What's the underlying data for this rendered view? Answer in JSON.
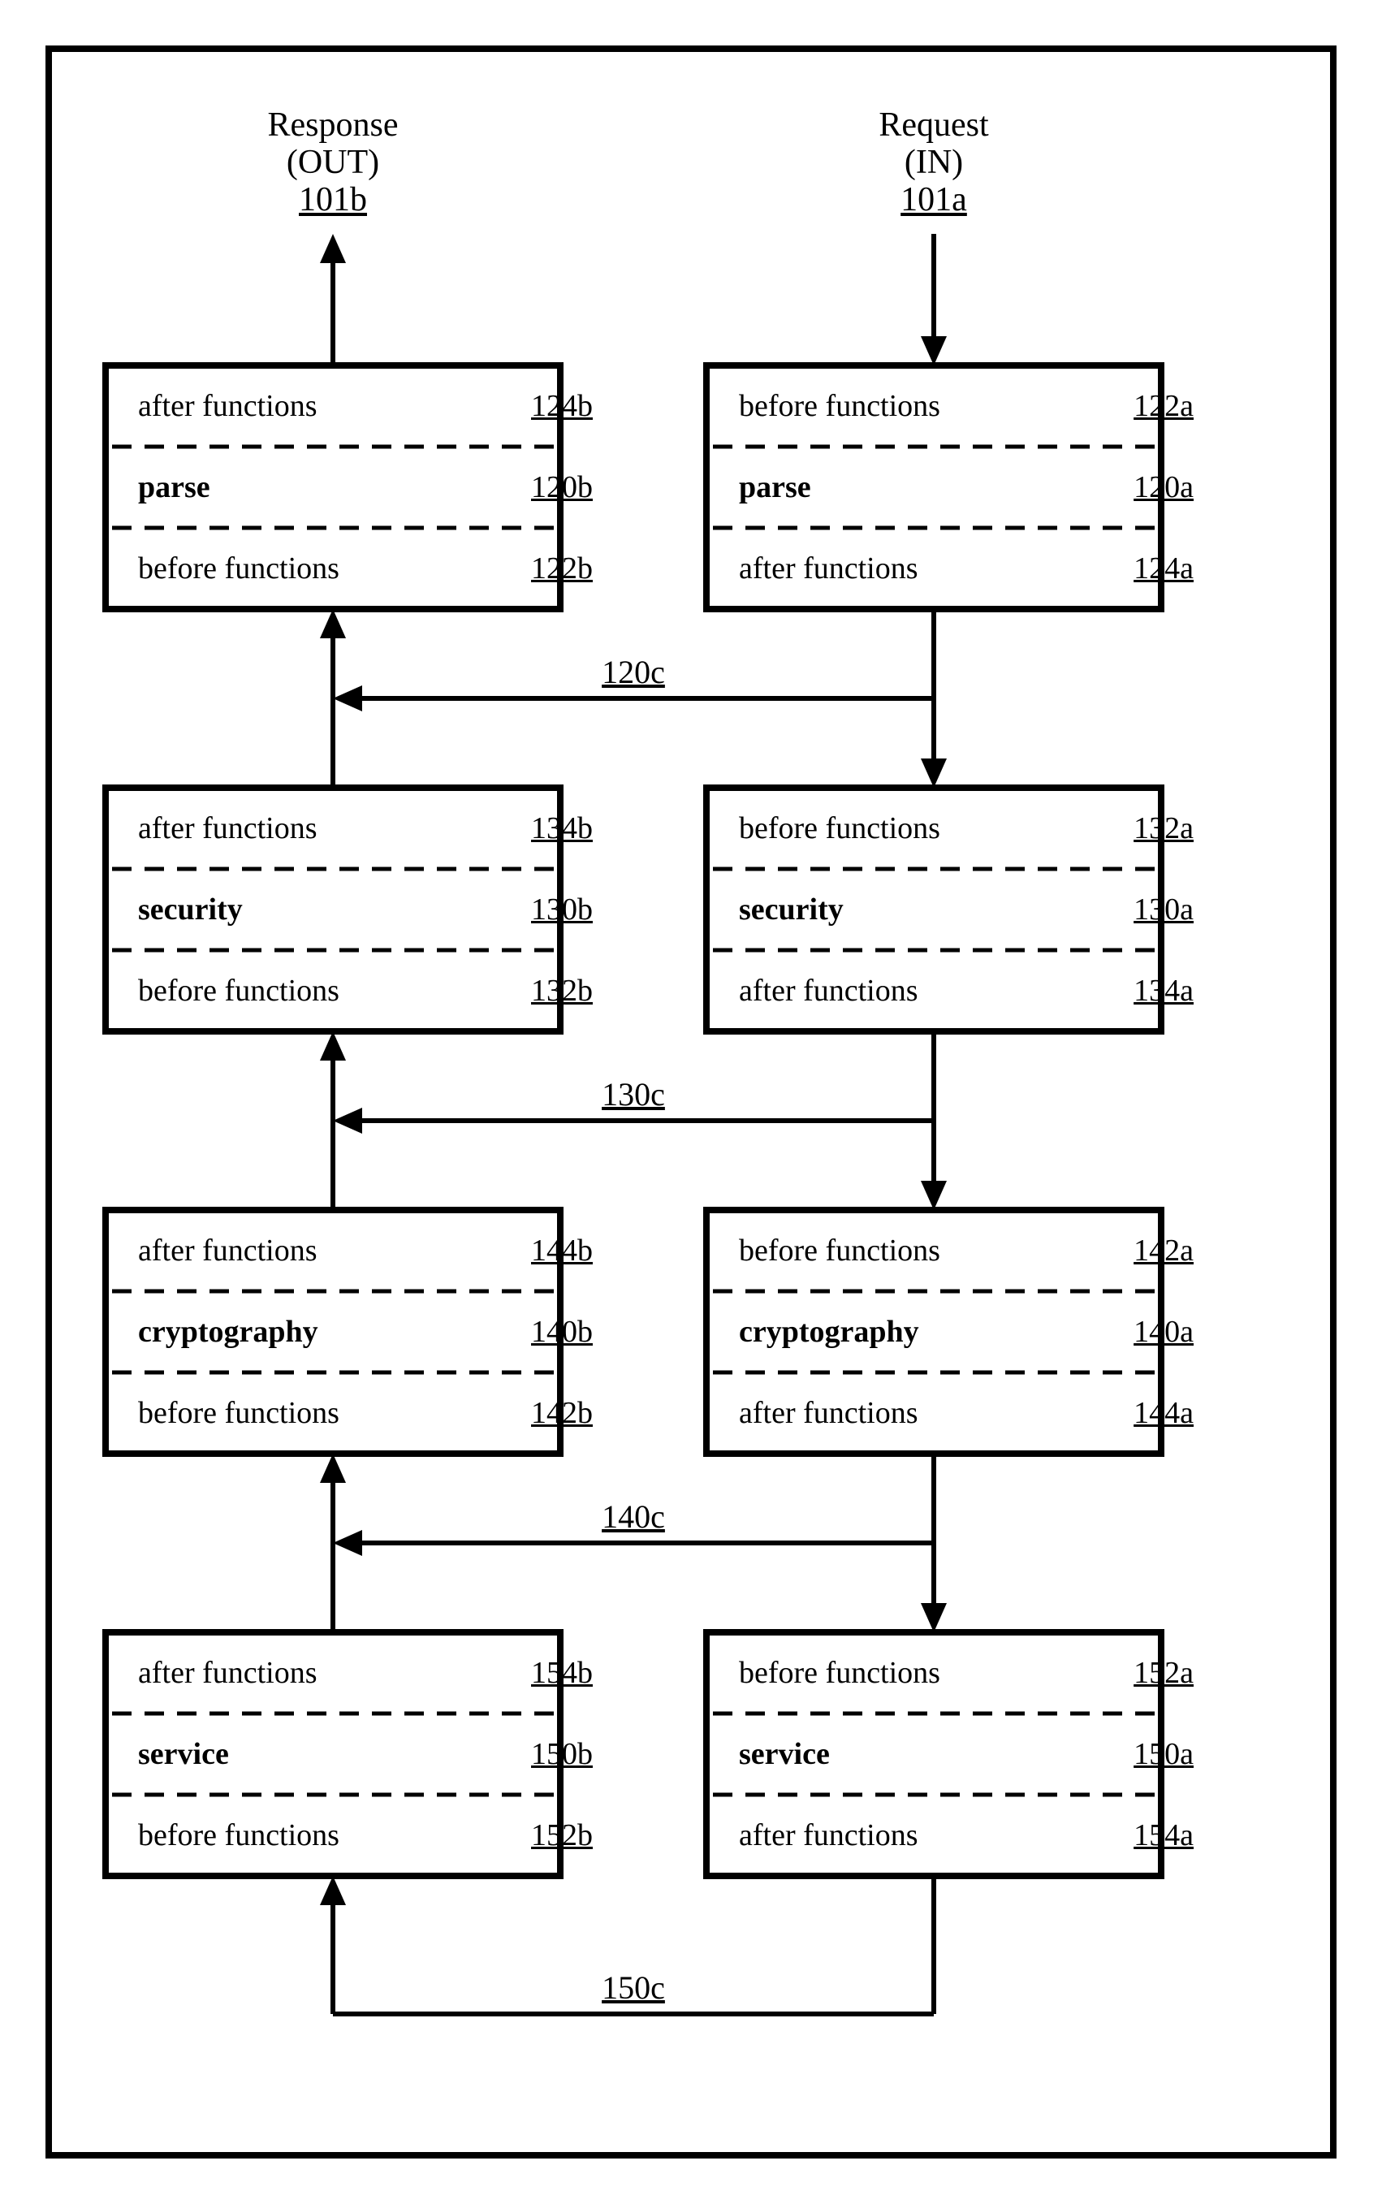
{
  "headers": {
    "left": {
      "l1": "Response",
      "l2": "(OUT)",
      "ref": "101b"
    },
    "right": {
      "l1": "Request",
      "l2": "(IN)",
      "ref": "101a"
    }
  },
  "row_labels": {
    "before": "before functions",
    "after": "after functions"
  },
  "stages": [
    {
      "name": "parse",
      "left_name_ref": "120b",
      "right_name_ref": "120a",
      "left_top_ref": "124b",
      "left_bot_ref": "122b",
      "right_top_ref": "122a",
      "right_bot_ref": "124a",
      "conn_ref": "120c"
    },
    {
      "name": "security",
      "left_name_ref": "130b",
      "right_name_ref": "130a",
      "left_top_ref": "134b",
      "left_bot_ref": "132b",
      "right_top_ref": "132a",
      "right_bot_ref": "134a",
      "conn_ref": "130c"
    },
    {
      "name": "cryptography",
      "left_name_ref": "140b",
      "right_name_ref": "140a",
      "left_top_ref": "144b",
      "left_bot_ref": "142b",
      "right_top_ref": "142a",
      "right_bot_ref": "144a",
      "conn_ref": "140c"
    },
    {
      "name": "service",
      "left_name_ref": "150b",
      "right_name_ref": "150a",
      "left_top_ref": "154b",
      "left_bot_ref": "152b",
      "right_top_ref": "152a",
      "right_bot_ref": "154a",
      "conn_ref": "150c"
    }
  ]
}
